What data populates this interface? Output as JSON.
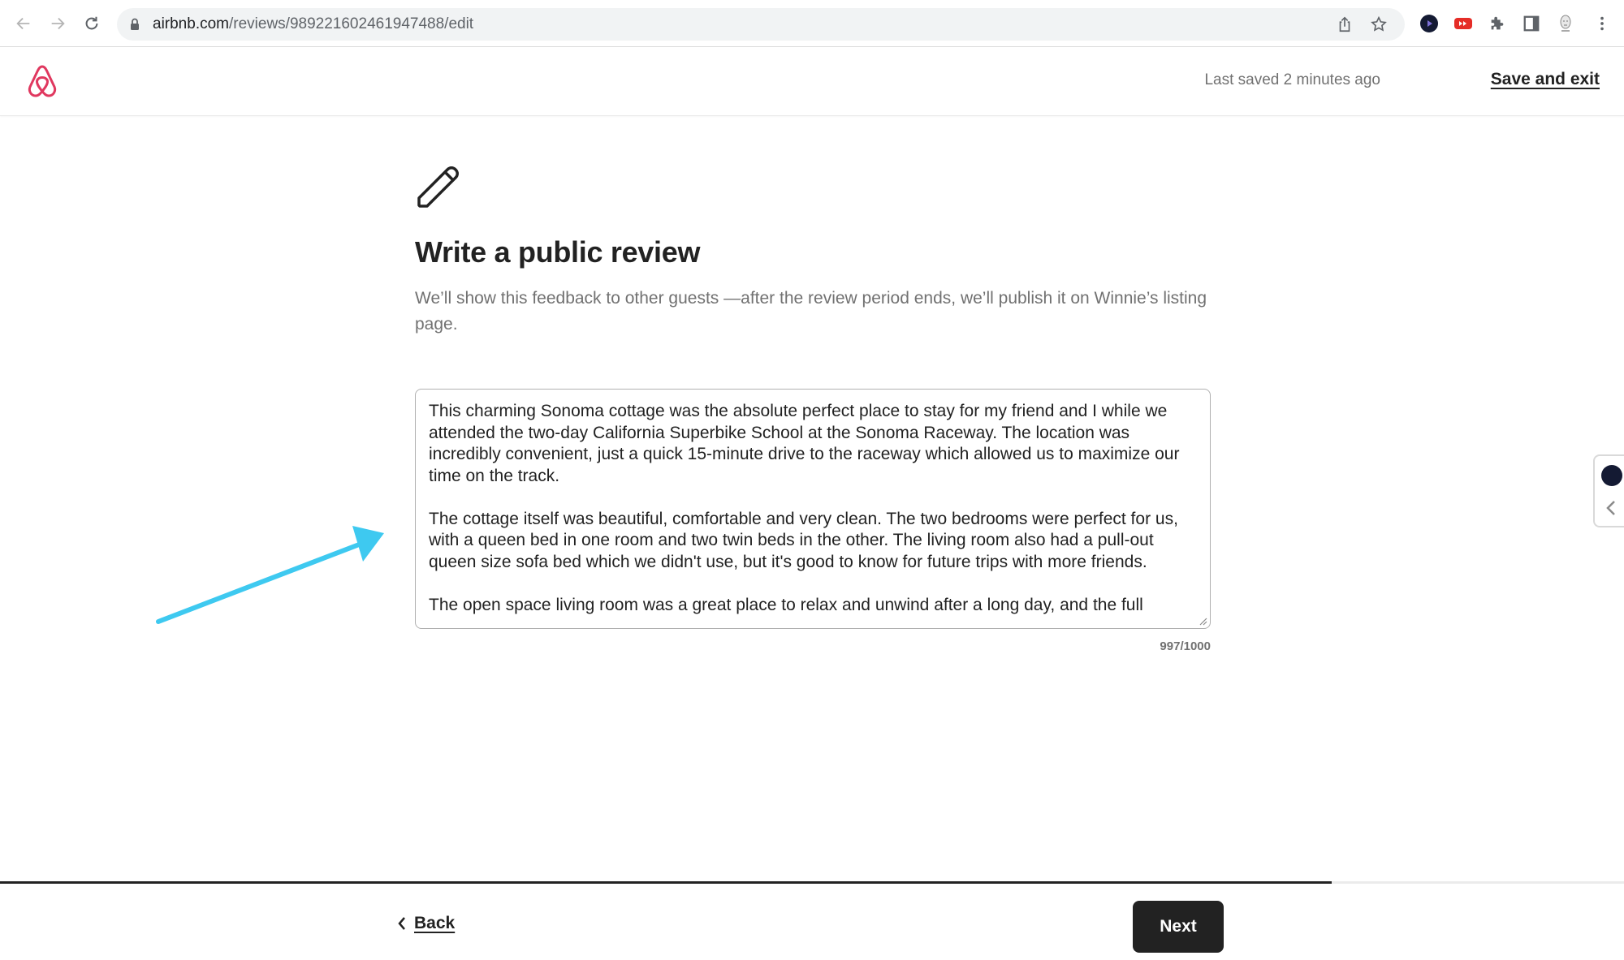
{
  "browser": {
    "url_host": "airbnb.com",
    "url_path": "/reviews/989221602461947488/edit",
    "icons": [
      "back-arrow-icon",
      "forward-arrow-icon",
      "reload-icon",
      "lock-icon",
      "share-icon",
      "bookmark-star-icon",
      "extension-play-icon",
      "extension-youtube-icon",
      "extensions-puzzle-icon",
      "side-panel-icon",
      "profile-avatar",
      "more-menu-icon"
    ]
  },
  "header": {
    "logo": "airbnb-logo-icon",
    "last_saved": "Last saved 2 minutes ago",
    "save_exit_label": "Save and exit"
  },
  "main": {
    "icon": "pencil-icon",
    "title": "Write a public review",
    "subtitle": "We’ll show this feedback to other guests —after the review period ends, we’ll publish it on Winnie’s listing page.",
    "review_text": "This charming Sonoma cottage was the absolute perfect place to stay for my friend and I while we attended the two-day California Superbike School at the Sonoma Raceway. The location was incredibly convenient, just a quick 15-minute drive to the raceway which allowed us to maximize our time on the track.\n\nThe cottage itself was beautiful, comfortable and very clean. The two bedrooms were perfect for us, with a queen bed in one room and two twin beds in the other. The living room also had a pull-out queen size sofa bed which we didn't use, but it's good to know for future trips with more friends.\n\nThe open space living room was a great place to relax and unwind after a long day, and the full",
    "char_count": "997/1000"
  },
  "annotation": {
    "type": "arrow",
    "color": "#3ec9f0",
    "points_to": "review-textarea"
  },
  "footer": {
    "progress_percent": 82,
    "back_label": "Back",
    "next_label": "Next"
  },
  "colors": {
    "brand": "#e0385f",
    "text_primary": "#222222",
    "text_secondary": "#717171",
    "button_dark": "#222222"
  }
}
